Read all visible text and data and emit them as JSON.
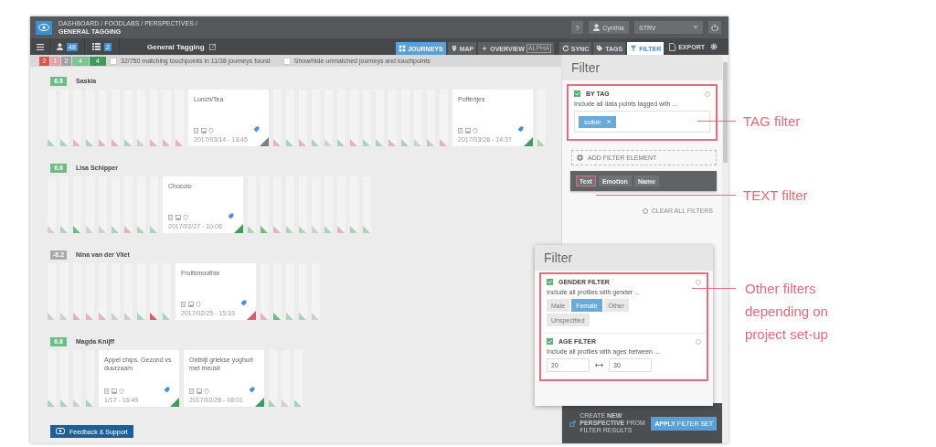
{
  "header": {
    "breadcrumb": "DASHBOARD / FOODLABS / PERSPECTIVES /",
    "page": "GENERAL TAGGING",
    "help": "?",
    "user": "Cynthia",
    "project": "STRV"
  },
  "toolbar": {
    "people_count": "48",
    "list_count": "2",
    "title": "General Tagging",
    "view_tabs": [
      {
        "kind": "grid",
        "label": "JOURNEYS",
        "selected": true
      },
      {
        "kind": "pin",
        "label": "MAP",
        "selected": false
      },
      {
        "kind": "bolt",
        "label": "OVERVIEW",
        "badge": "ALPHA",
        "selected": false
      }
    ],
    "tool_tabs": [
      {
        "kind": "sync",
        "label": "SYNC",
        "selected": false
      },
      {
        "kind": "tag",
        "label": "TAGS",
        "selected": false
      },
      {
        "kind": "funnel",
        "label": "FILTER",
        "selected": true
      }
    ],
    "export": "EXPORT"
  },
  "summary": {
    "scores": [
      {
        "label": "2",
        "color": "#d9534f"
      },
      {
        "label": "1",
        "color": "#e8a0a6"
      },
      {
        "label": "2",
        "color": "#a0a0a0"
      },
      {
        "label": "4",
        "color": "#7cc592"
      },
      {
        "label": "4",
        "color": "#3e9b5a"
      }
    ],
    "matches": {
      "checked": false,
      "text": "32/750 matching touchpoints in 11/38 journeys found"
    },
    "toggle": {
      "checked": false,
      "text": "Show/hide unmatched journeys and touchpoints"
    }
  },
  "journeys": [
    {
      "score": "6.8",
      "color": "#6dbb85",
      "name": "Saskia",
      "touchpoints": [
        {
          "kind": "strip",
          "color": "#a9d5b5"
        },
        {
          "kind": "strip",
          "color": "#a9d5b5"
        },
        {
          "kind": "strip",
          "color": "#e6b3b8"
        },
        {
          "kind": "strip",
          "color": "#a9d5b5"
        },
        {
          "kind": "strip",
          "color": "#e6b3b8"
        },
        {
          "kind": "strip",
          "color": "#e6b3b8"
        },
        {
          "kind": "strip",
          "color": "#a9d5b5"
        },
        {
          "kind": "strip",
          "color": "#cfcfcf"
        },
        {
          "kind": "strip",
          "color": "#e6b3b8"
        },
        {
          "kind": "strip",
          "color": "#e6b3b8"
        },
        {
          "kind": "strip",
          "color": "#e6b3b8"
        },
        {
          "kind": "card",
          "title": "Lunch/Tea",
          "date": "2017/03/14 - 13:45",
          "color": "#7d7d7d"
        },
        {
          "kind": "strip",
          "color": "#e6b3b8"
        },
        {
          "kind": "strip",
          "color": "#a9d5b5"
        },
        {
          "kind": "strip",
          "color": "#e6b3b8"
        },
        {
          "kind": "strip",
          "color": "#a9d5b5"
        },
        {
          "kind": "strip",
          "color": "#cfcfcf"
        },
        {
          "kind": "strip",
          "color": "#a9d5b5"
        },
        {
          "kind": "strip",
          "color": "#e6b3b8"
        },
        {
          "kind": "strip",
          "color": "#a9d5b5"
        },
        {
          "kind": "strip",
          "color": "#a9d5b5"
        },
        {
          "kind": "strip",
          "color": "#e6b3b8"
        },
        {
          "kind": "strip",
          "color": "#a9d5b5"
        },
        {
          "kind": "strip",
          "color": "#cfcfcf"
        },
        {
          "kind": "strip",
          "color": "#a9d5b5"
        },
        {
          "kind": "strip",
          "color": "#e6b3b8"
        },
        {
          "kind": "card",
          "title": "Poffertjes",
          "date": "2017/03/26 - 14:37",
          "color": "#3e9b5a"
        },
        {
          "kind": "strip",
          "color": "#a9d5b5"
        }
      ]
    },
    {
      "score": "6.8",
      "color": "#6dbb85",
      "name": "Lisa Schipper",
      "touchpoints": [
        {
          "kind": "strip",
          "color": "#cfcfcf"
        },
        {
          "kind": "strip",
          "color": "#a9d5b5"
        },
        {
          "kind": "strip",
          "color": "#6dbb85"
        },
        {
          "kind": "strip",
          "color": "#cfcfcf"
        },
        {
          "kind": "strip",
          "color": "#cfcfcf"
        },
        {
          "kind": "strip",
          "color": "#a9d5b5"
        },
        {
          "kind": "strip",
          "color": "#e6b3b8"
        },
        {
          "kind": "strip",
          "color": "#a9d5b5"
        },
        {
          "kind": "strip",
          "color": "#a9d5b5"
        },
        {
          "kind": "card",
          "title": "Chocolo",
          "date": "2017/02/27 - 10:08",
          "color": "#3e9b5a"
        },
        {
          "kind": "strip",
          "color": "#a9d5b5"
        },
        {
          "kind": "strip",
          "color": "#6dbb85"
        },
        {
          "kind": "strip",
          "color": "#e6b3b8"
        },
        {
          "kind": "strip",
          "color": "#a9d5b5"
        },
        {
          "kind": "strip",
          "color": "#a9d5b5"
        },
        {
          "kind": "strip",
          "color": "#cfcfcf"
        },
        {
          "kind": "strip",
          "color": "#a9d5b5"
        },
        {
          "kind": "strip",
          "color": "#e6b3b8"
        },
        {
          "kind": "strip",
          "color": "#a9d5b5"
        },
        {
          "kind": "strip",
          "color": "#a9d5b5"
        }
      ]
    },
    {
      "score": "-6.2",
      "color": "#aaaaaa",
      "name": "Nina van der Vliet",
      "touchpoints": [
        {
          "kind": "strip",
          "color": "#cfcfcf"
        },
        {
          "kind": "strip",
          "color": "#cfcfcf"
        },
        {
          "kind": "strip",
          "color": "#e6b3b8"
        },
        {
          "kind": "strip",
          "color": "#e6b3b8"
        },
        {
          "kind": "strip",
          "color": "#e6b3b8"
        },
        {
          "kind": "strip",
          "color": "#cfcfcf"
        },
        {
          "kind": "strip",
          "color": "#cfcfcf"
        },
        {
          "kind": "strip",
          "color": "#a9d5b5"
        },
        {
          "kind": "strip",
          "color": "#d0616b"
        },
        {
          "kind": "strip",
          "color": "#a9d5b5"
        },
        {
          "kind": "card",
          "title": "Fruitsmoothie",
          "date": "2017/02/25 - 15:33",
          "color": "#d0616b"
        },
        {
          "kind": "strip",
          "color": "#e6b3b8"
        },
        {
          "kind": "strip",
          "color": "#6dbb85"
        },
        {
          "kind": "strip",
          "color": "#a9d5b5"
        },
        {
          "kind": "strip",
          "color": "#a9d5b5"
        },
        {
          "kind": "strip",
          "color": "#cfcfcf"
        }
      ]
    },
    {
      "score": "6.8",
      "color": "#6dbb85",
      "name": "Magda Knijff",
      "touchpoints": [
        {
          "kind": "strip",
          "color": "#a9d5b5"
        },
        {
          "kind": "strip",
          "color": "#a9d5b5"
        },
        {
          "kind": "strip",
          "color": "#cfcfcf"
        },
        {
          "kind": "strip",
          "color": "#a9d5b5"
        },
        {
          "kind": "card",
          "title": "Appel chips. Gezond vs duurzaam",
          "date": "1/17 - 16:49",
          "color": "#3e9b5a"
        },
        {
          "kind": "card",
          "title": "Ontbijt griekse yoghurt met meusli",
          "date": "2017/02/28 - 08:01",
          "color": "#3e9b5a"
        },
        {
          "kind": "strip",
          "color": "#a9d5b5"
        },
        {
          "kind": "strip",
          "color": "#cfcfcf"
        },
        {
          "kind": "strip",
          "color": "#a9d5b5"
        }
      ]
    }
  ],
  "feedback": "Feedback & Support",
  "filter_panel": {
    "title": "Filter",
    "tag_filter": {
      "checked": true,
      "title": "BY TAG",
      "description": "Include all data points tagged with ...",
      "tags": [
        "suiker"
      ],
      "highlighted": true
    },
    "add_element": "ADD FILTER ELEMENT",
    "element_options": [
      {
        "label": "Text",
        "highlighted": true
      },
      {
        "label": "Emotion",
        "highlighted": false
      },
      {
        "label": "Name",
        "highlighted": false
      }
    ],
    "clear": "CLEAR ALL FILTERS",
    "create": "CREATE **NEW PERSPECTIVE** FROM FILTER RESULTS",
    "apply": "**APPLY** FILTER SET"
  },
  "inset_panel": {
    "title": "Filter",
    "highlighted": true,
    "gender_filter": {
      "checked": true,
      "title": "GENDER FILTER",
      "description": "Include all profiles with gender ...",
      "options": [
        {
          "label": "Male",
          "selected": false
        },
        {
          "label": "Female",
          "selected": true
        },
        {
          "label": "Other",
          "selected": false
        },
        {
          "label": "Unspecified",
          "selected": false
        }
      ]
    },
    "age_filter": {
      "checked": true,
      "title": "AGE FILTER",
      "description": "Include all profiles with ages between ...",
      "from": "20",
      "to": "30"
    }
  },
  "annotations": [
    {
      "label": "TAG filter"
    },
    {
      "label": "TEXT filter"
    },
    {
      "label": "Other filters depending on project set-up"
    }
  ]
}
